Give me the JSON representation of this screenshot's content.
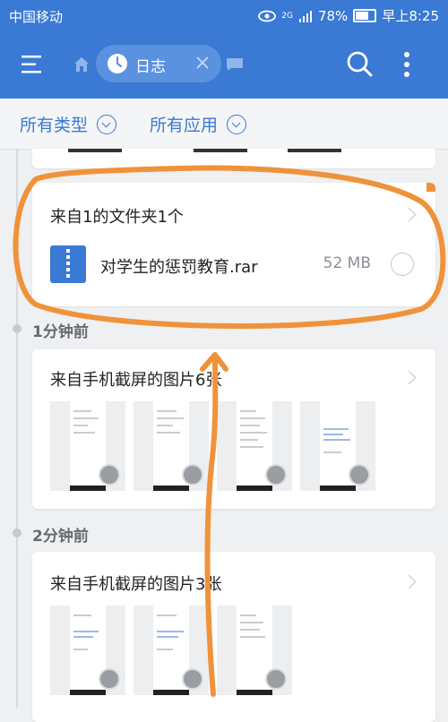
{
  "status_bar": {
    "carrier": "中国移动",
    "network": "2G",
    "battery": "78%",
    "battery_level": 0.78,
    "time": "早上8:25"
  },
  "app_bar": {
    "tab_label": "日志"
  },
  "filters": {
    "type_label": "所有类型",
    "app_label": "所有应用"
  },
  "card_folder": {
    "title": "来自1的文件夹1个",
    "file_name": "对学生的惩罚教育.rar",
    "file_size": "52 MB"
  },
  "sections": [
    {
      "label": "1分钟前",
      "card_title": "来自手机截屏的图片6张",
      "thumb_count_shown": 4
    },
    {
      "label": "2分钟前",
      "card_title": "来自手机截屏的图片3张",
      "thumb_count_shown": 3
    }
  ],
  "colors": {
    "accent": "#3a79d4",
    "annotation": "#f0923a"
  }
}
